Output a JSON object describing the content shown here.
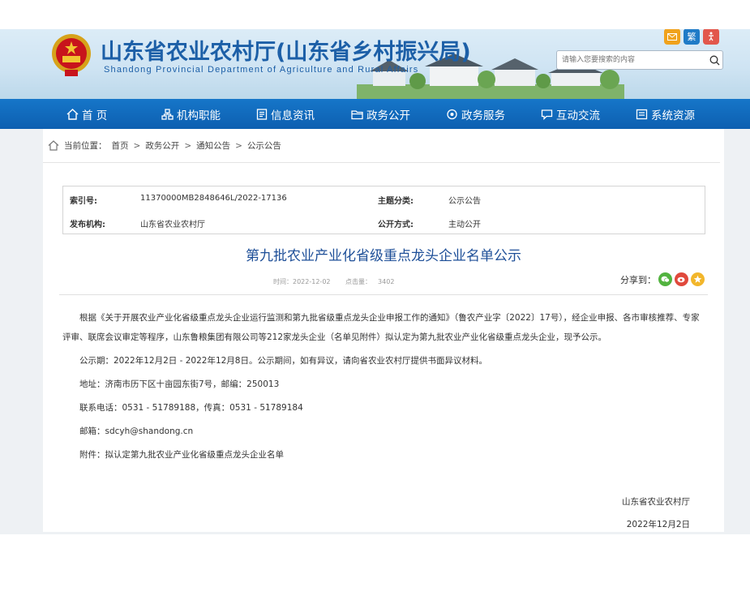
{
  "header": {
    "title": "山东省农业农村厅(山东省乡村振兴局)",
    "subtitle": "Shandong Provincial Department of Agriculture and Rural Affairs",
    "search_placeholder": "请输入您要搜索的内容",
    "traditional_label": "繁"
  },
  "nav": {
    "items": [
      {
        "label": "首 页",
        "icon": "home-icon"
      },
      {
        "label": "机构职能",
        "icon": "org-icon"
      },
      {
        "label": "信息资讯",
        "icon": "info-icon"
      },
      {
        "label": "政务公开",
        "icon": "folder-icon"
      },
      {
        "label": "政务服务",
        "icon": "service-icon"
      },
      {
        "label": "互动交流",
        "icon": "chat-icon"
      },
      {
        "label": "系统资源",
        "icon": "resource-icon"
      }
    ]
  },
  "breadcrumb": {
    "prefix": "当前位置：",
    "items": [
      "首页",
      "政务公开",
      "通知公告",
      "公示公告"
    ]
  },
  "meta": {
    "index_label": "索引号:",
    "index_value": "11370000MB2848646L/2022-17136",
    "topic_label": "主题分类:",
    "topic_value": "公示公告",
    "publisher_label": "发布机构:",
    "publisher_value": "山东省农业农村厅",
    "mode_label": "公开方式:",
    "mode_value": "主动公开"
  },
  "article": {
    "title": "第九批农业产业化省级重点龙头企业名单公示",
    "time_label": "时间：",
    "time_value": "2022-12-02",
    "clicks_label": "点击量：",
    "clicks_value": "3402",
    "share_label": "分享到：",
    "paragraphs": [
      "根据《关于开展农业产业化省级重点龙头企业运行监测和第九批省级重点龙头企业申报工作的通知》（鲁农产业字〔2022〕17号），经企业申报、各市审核推荐、专家评审、联席会议审定等程序，山东鲁粮集团有限公司等212家龙头企业（名单见附件）拟认定为第九批农业产业化省级重点龙头企业，现予公示。",
      "公示期：2022年12月2日 - 2022年12月8日。公示期间，如有异议，请向省农业农村厅提供书面异议材料。",
      "地址：济南市历下区十亩园东街7号，邮编：250013",
      "联系电话：0531 - 51789188，传真：0531 - 51789184",
      "邮箱：sdcyh@shandong.cn",
      "附件：拟认定第九批农业产业化省级重点龙头企业名单"
    ],
    "signature": "山东省农业农村厅",
    "sign_date": "2022年12月2日"
  }
}
